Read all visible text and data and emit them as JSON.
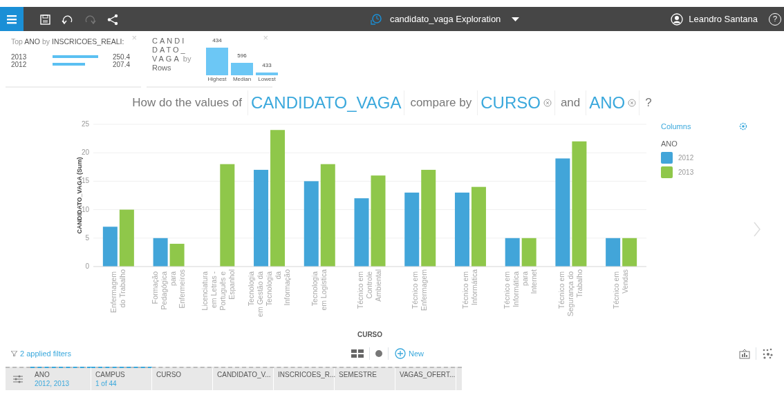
{
  "toolbar": {
    "title": "candidato_vaga Exploration",
    "user": "Leandro Santana",
    "help": "?",
    "undo_enabled": true,
    "redo_enabled": false
  },
  "widgets": [
    {
      "kind": "toplist",
      "close": "×",
      "title": "Top **ANO** by **INSCRICOES_REALI:**",
      "rows": [
        {
          "label": "2013",
          "value": "250.4"
        },
        {
          "label": "2012",
          "value": "207.4"
        }
      ]
    },
    {
      "kind": "stats",
      "close": "×",
      "title": "CANDI",
      "title_1b": "DATO_",
      "title_2": "VAGA",
      "by": "by",
      "subtitle": "Rows",
      "bars": [
        {
          "label": "Highest",
          "value": "434"
        },
        {
          "label": "Median",
          "value": "596"
        },
        {
          "label": "Lowest",
          "value": "433"
        }
      ]
    }
  ],
  "question": [
    {
      "kind": "text",
      "text": "How do the values of"
    },
    {
      "kind": "field",
      "text": "CANDIDATO_VAGA",
      "removable": false
    },
    {
      "kind": "text",
      "text": "compare by"
    },
    {
      "kind": "field",
      "text": "CURSO",
      "removable": true
    },
    {
      "kind": "text",
      "text": "and"
    },
    {
      "kind": "field",
      "text": "ANO",
      "removable": true
    },
    {
      "kind": "text",
      "text": "?"
    }
  ],
  "chart_data": {
    "type": "bar",
    "grid": true,
    "xlabel": "CURSO",
    "ylabel": "CANDIDATO_VAGA (Sum)",
    "ylim": [
      0,
      25
    ],
    "yticks": [
      0,
      5,
      10,
      15,
      20,
      25
    ],
    "categories": [
      "Enfermagem do Trabalho",
      "Formação Pedagógica para Enfermeiros",
      "Licenciatura em Letras - Português e Espanhol",
      "Tecnologia em Gestão da Tecnologia da Informação",
      "Tecnologia em Logística",
      "Técnico em Controle Ambiental",
      "Técnico em Enfermagem",
      "Técnico em Informática",
      "Técnico em Informática para Internet",
      "Técnico em Segurança do Trabalho",
      "Técnico em Vendas"
    ],
    "series": [
      {
        "name": "2012",
        "color": "#42a5d9",
        "values": [
          7,
          5,
          null,
          17,
          15,
          12,
          13,
          13,
          5,
          19,
          5
        ]
      },
      {
        "name": "2013",
        "color": "#8fc74a",
        "values": [
          10,
          4,
          18,
          24,
          18,
          16,
          17,
          14,
          5,
          22,
          5
        ]
      }
    ]
  },
  "legend": {
    "title": "Columns",
    "field": "ANO"
  },
  "filters": {
    "label": "2 applied filters",
    "new_label": "New"
  },
  "fields": [
    {
      "name": "ANO",
      "detail": "2012, 2013"
    },
    {
      "name": "CAMPUS",
      "detail": "1 of 44"
    },
    {
      "name": "CURSO"
    },
    {
      "name": "CANDIDATO_V..."
    },
    {
      "name": "INSCRICOES_R..."
    },
    {
      "name": "SEMESTRE"
    },
    {
      "name": "VAGAS_OFERT..."
    }
  ]
}
